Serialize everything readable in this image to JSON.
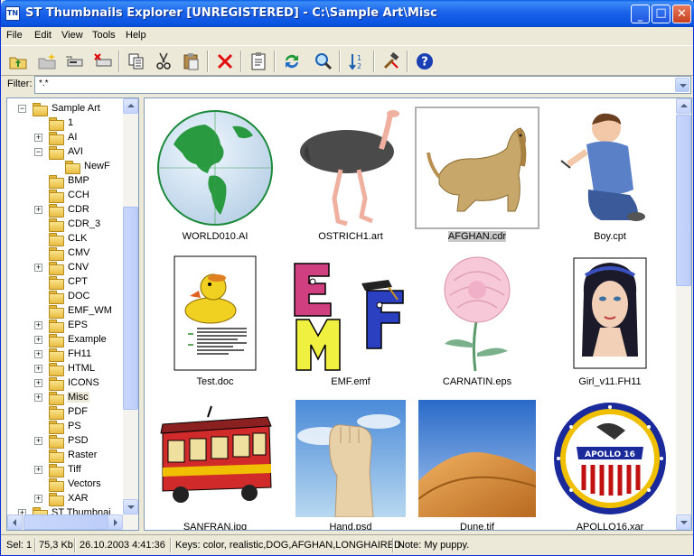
{
  "window": {
    "title": "ST Thumbnails Explorer [UNREGISTERED] - C:\\Sample Art\\Misc",
    "app_icon_text": "TN"
  },
  "menu": [
    "File",
    "Edit",
    "View",
    "Tools",
    "Help"
  ],
  "toolbar": {
    "tools": [
      "folder-up-icon",
      "new-folder-icon",
      "map-drive-icon",
      "disconnect-drive-icon",
      "copy-icon",
      "cut-icon",
      "paste-icon",
      "delete-icon",
      "properties-icon",
      "refresh-icon",
      "search-icon",
      "sort-icon",
      "tools-icon",
      "help-icon"
    ]
  },
  "filter": {
    "label": "Filter:",
    "value": "*.*"
  },
  "tree": {
    "items": [
      {
        "label": "Sample Art",
        "expander": "−"
      },
      {
        "label": "1",
        "expander": ""
      },
      {
        "label": "AI",
        "expander": "+"
      },
      {
        "label": "AVI",
        "expander": "−"
      },
      {
        "label": "NewF",
        "expander": ""
      },
      {
        "label": "BMP",
        "expander": ""
      },
      {
        "label": "CCH",
        "expander": ""
      },
      {
        "label": "CDR",
        "expander": "+"
      },
      {
        "label": "CDR_3",
        "expander": ""
      },
      {
        "label": "CLK",
        "expander": ""
      },
      {
        "label": "CMV",
        "expander": ""
      },
      {
        "label": "CNV",
        "expander": "+"
      },
      {
        "label": "CPT",
        "expander": ""
      },
      {
        "label": "DOC",
        "expander": ""
      },
      {
        "label": "EMF_WM",
        "expander": ""
      },
      {
        "label": "EPS",
        "expander": "+"
      },
      {
        "label": "Example",
        "expander": "+"
      },
      {
        "label": "FH11",
        "expander": "+"
      },
      {
        "label": "HTML",
        "expander": "+"
      },
      {
        "label": "ICONS",
        "expander": "+"
      },
      {
        "label": "Misc",
        "expander": "+"
      },
      {
        "label": "PDF",
        "expander": ""
      },
      {
        "label": "PS",
        "expander": ""
      },
      {
        "label": "PSD",
        "expander": "+"
      },
      {
        "label": "Raster",
        "expander": ""
      },
      {
        "label": "Tiff",
        "expander": "+"
      },
      {
        "label": "Vectors",
        "expander": ""
      },
      {
        "label": "XAR",
        "expander": "+"
      },
      {
        "label": "ST Thumbnai",
        "expander": "+"
      }
    ],
    "selected": "Misc"
  },
  "thumbnails": [
    {
      "label": "WORLD010.AI",
      "icon": "globe-icon"
    },
    {
      "label": "OSTRICH1.art",
      "icon": "ostrich-icon"
    },
    {
      "label": "AFGHAN.cdr",
      "icon": "dog-icon",
      "selected": true
    },
    {
      "label": "Boy.cpt",
      "icon": "boy-photo"
    },
    {
      "label": "Test.doc",
      "icon": "duck-document-icon"
    },
    {
      "label": "EMF.emf",
      "icon": "emf-letters-icon"
    },
    {
      "label": "CARNATIN.eps",
      "icon": "carnation-icon"
    },
    {
      "label": "Girl_v11.FH11",
      "icon": "girl-portrait-icon"
    },
    {
      "label": "SANFRAN.jpg",
      "icon": "trolley-icon"
    },
    {
      "label": "Hand.psd",
      "icon": "hand-photo"
    },
    {
      "label": "Dune.tif",
      "icon": "dune-photo"
    },
    {
      "label": "APOLLO16.xar",
      "icon": "apollo-patch-icon"
    }
  ],
  "apollo_patch_text": "APOLLO 16",
  "status": {
    "selection": "Sel: 1",
    "size": "75,3 Kb",
    "date": "26.10.2003 4:41:36",
    "keys": "Keys: color, realistic,DOG,AFGHAN,LONGHAIRED",
    "note": "Note: My puppy."
  }
}
